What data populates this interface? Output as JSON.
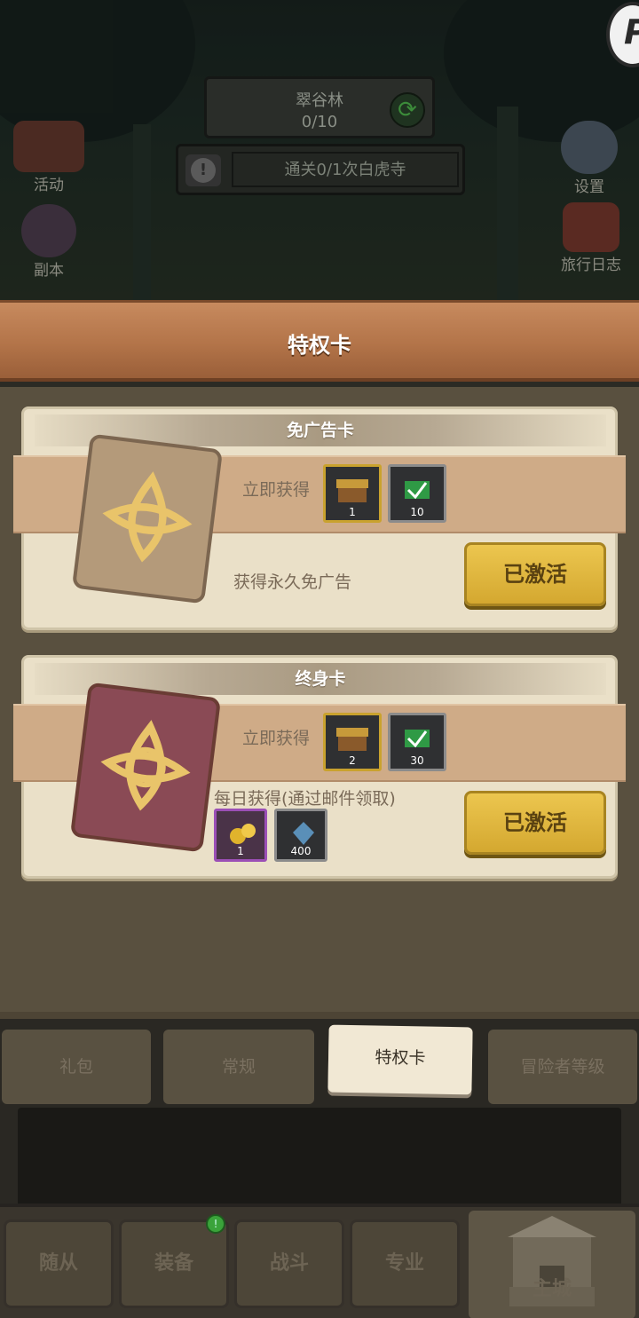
{
  "scene": {
    "map_name": "翠谷林",
    "map_progress": "0/10",
    "quest_text": "通关0/1次白虎寺",
    "badge_letter": "P",
    "left_icons": [
      {
        "label": "活动",
        "icon": "calendar-icon"
      },
      {
        "label": "副本",
        "icon": "portal-icon"
      }
    ],
    "right_icons": [
      {
        "label": "设置",
        "icon": "gear-icon"
      },
      {
        "label": "旅行日志",
        "icon": "journal-icon"
      }
    ]
  },
  "header": {
    "title": "特权卡"
  },
  "cards": [
    {
      "title": "免广告卡",
      "instant_label": "立即获得",
      "instant_items": [
        {
          "icon": "gold-chest-icon",
          "count": "1",
          "rarity": "gold"
        },
        {
          "icon": "green-ticket-icon",
          "count": "10",
          "rarity": "gray"
        }
      ],
      "desc": "获得永久免广告",
      "button": "已激活",
      "art_color": "#b49a7a"
    },
    {
      "title": "终身卡",
      "instant_label": "立即获得",
      "instant_items": [
        {
          "icon": "gold-chest-icon",
          "count": "2",
          "rarity": "gold"
        },
        {
          "icon": "green-ticket-icon",
          "count": "30",
          "rarity": "gray"
        }
      ],
      "daily_label": "每日获得(通过邮件领取)",
      "daily_items": [
        {
          "icon": "gold-ore-icon",
          "count": "1",
          "rarity": "purple"
        },
        {
          "icon": "blue-gem-icon",
          "count": "400",
          "rarity": "gray"
        }
      ],
      "button": "已激活",
      "art_color": "#8a4a55"
    }
  ],
  "tabs": [
    {
      "label": "礼包",
      "active": false
    },
    {
      "label": "常规",
      "active": false
    },
    {
      "label": "特权卡",
      "active": true
    },
    {
      "label": "冒险者等级",
      "active": false
    }
  ],
  "bottom_nav": [
    {
      "label": "随从"
    },
    {
      "label": "装备",
      "badge": "!"
    },
    {
      "label": "战斗"
    },
    {
      "label": "专业"
    },
    {
      "label": "主城"
    }
  ]
}
